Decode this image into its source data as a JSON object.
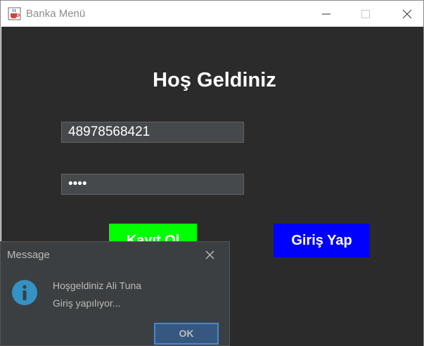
{
  "window": {
    "title": "Banka Menü"
  },
  "main": {
    "heading": "Hoş Geldiniz",
    "tc_input_value": "48978568421",
    "password_mask": "••••",
    "register_label": "Kayıt Ol",
    "login_label": "Giriş Yap"
  },
  "dialog": {
    "title": "Message",
    "line1": "Hoşgeldiniz Ali Tuna",
    "line2": "Giriş yapılıyor...",
    "ok_label": "OK"
  },
  "colors": {
    "background": "#2b2b2b",
    "register": "#00ff00",
    "login": "#0000ff",
    "dialog_bg": "#3c3f41",
    "info": "#3592c4"
  },
  "icons": [
    "java-cup-icon",
    "minimize-icon",
    "maximize-icon",
    "close-icon",
    "info-icon"
  ]
}
